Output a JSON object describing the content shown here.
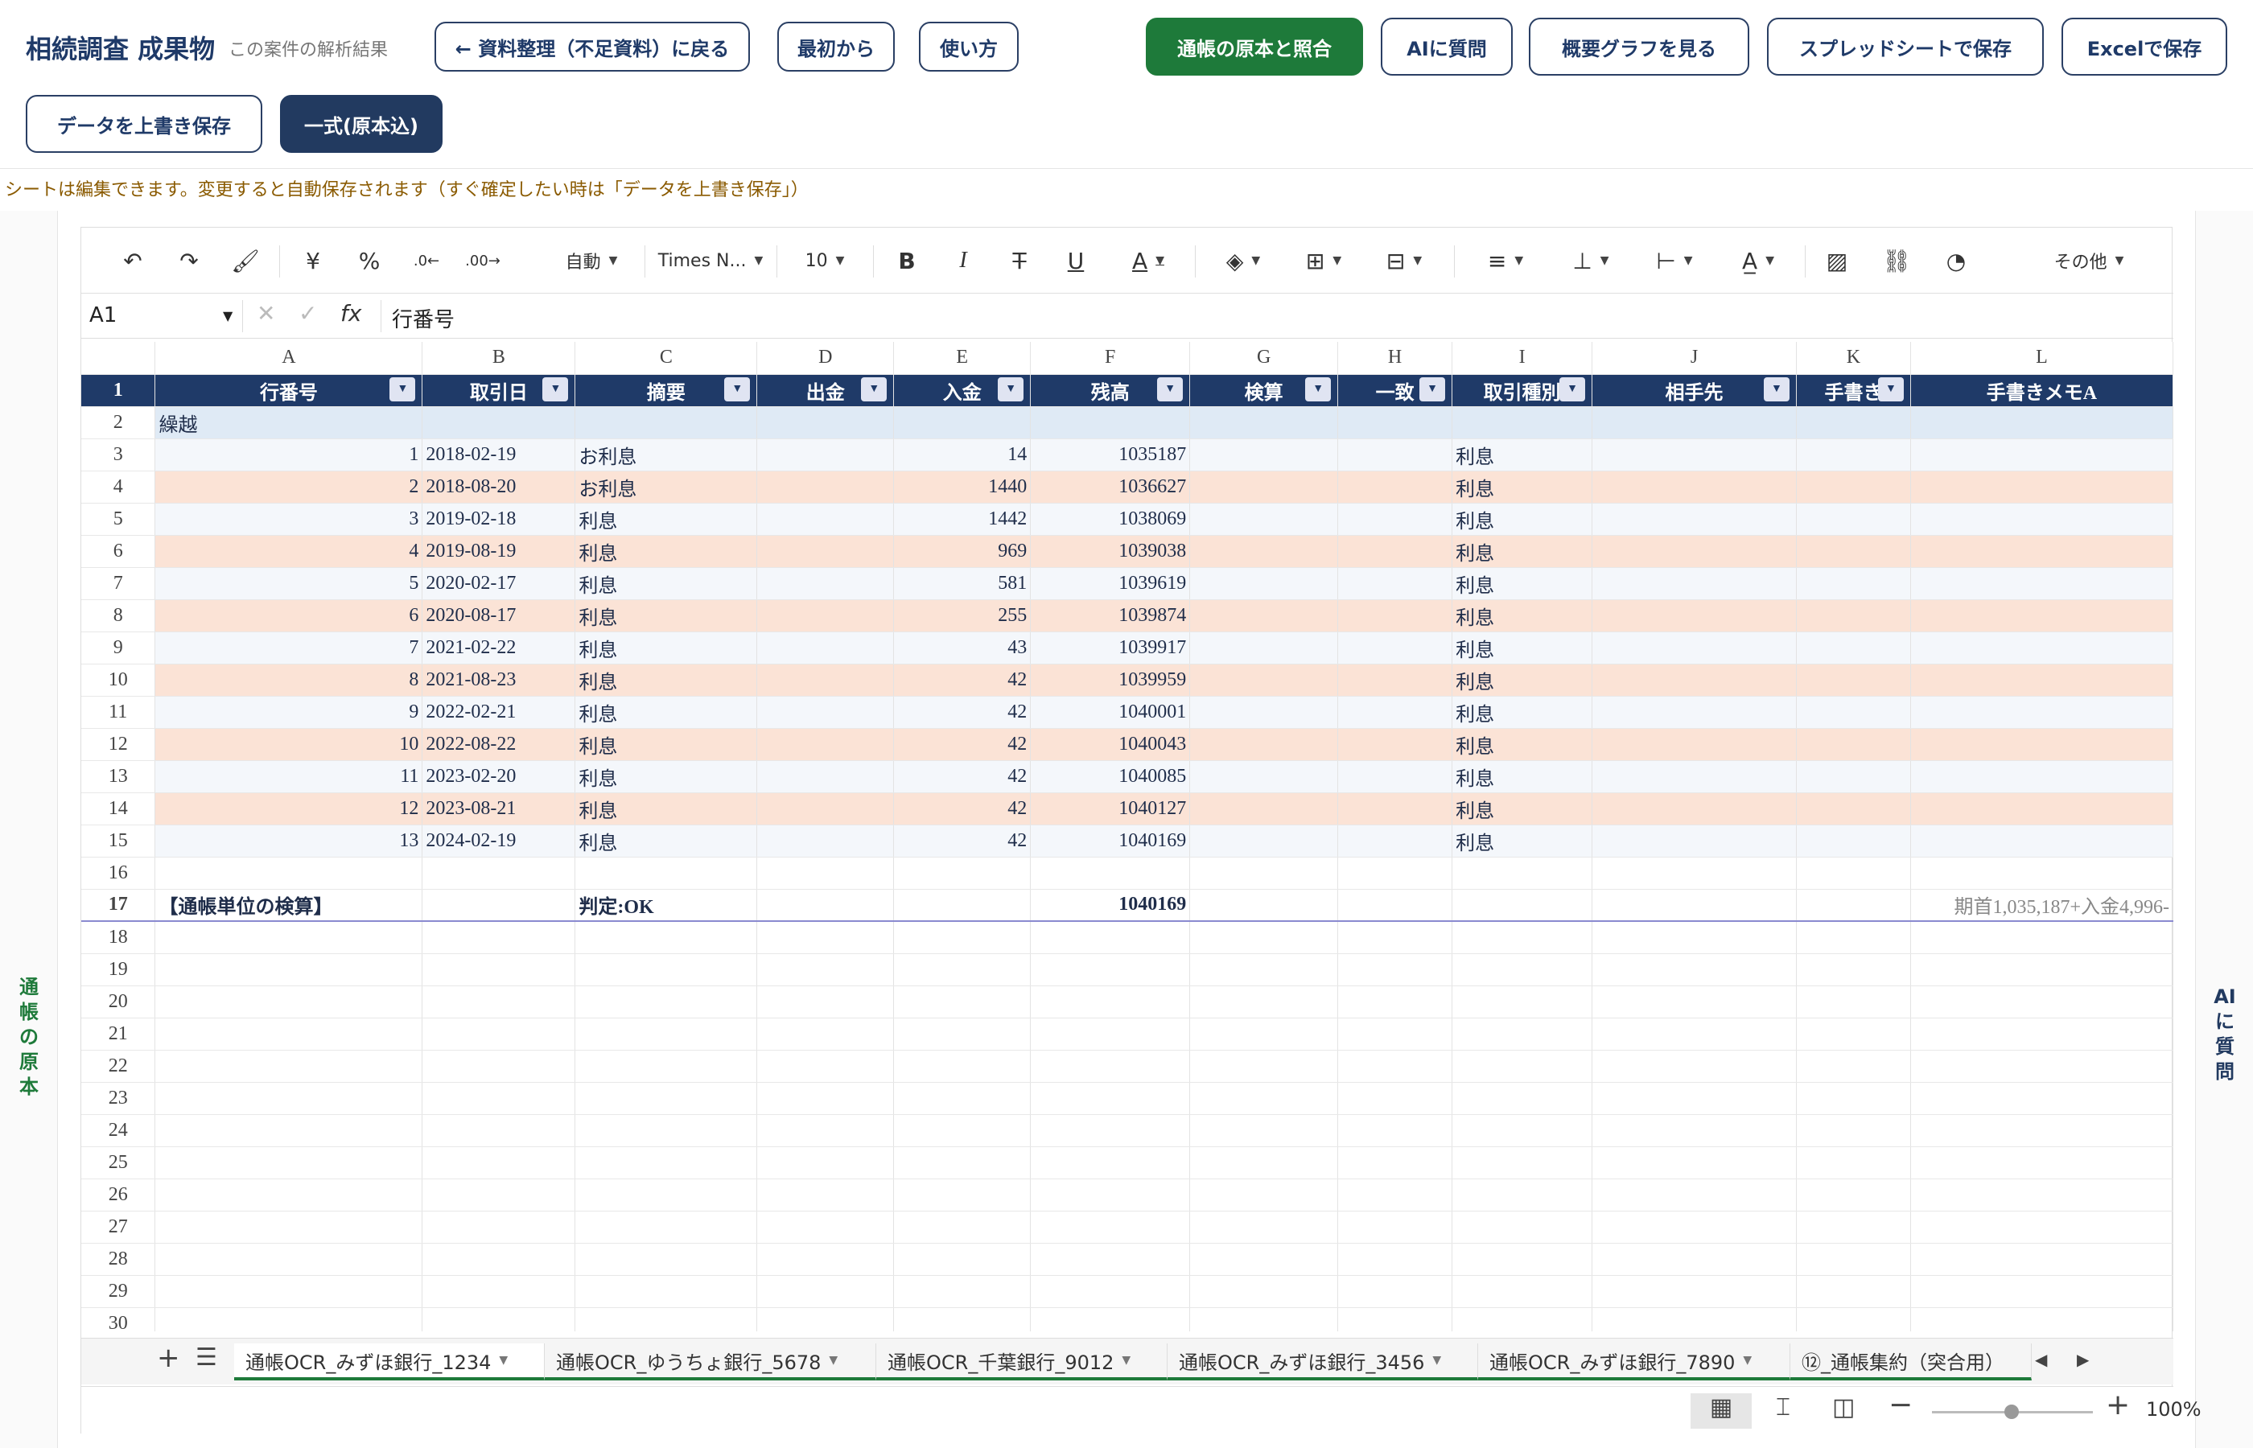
{
  "app": {
    "title": "相続調査 成果物",
    "subtitle": "この案件の解析結果"
  },
  "buttons": {
    "back": "← 資料整理（不足資料）に戻る",
    "restart": "最初から",
    "howto": "使い方",
    "compare": "通帳の原本と照合",
    "ask_ai": "AIに質問",
    "graph": "概要グラフを見る",
    "save_sheet": "スプレッドシートで保存",
    "save_excel": "Excelで保存",
    "overwrite": "データを上書き保存",
    "full_set": "一式(原本込)"
  },
  "notice": "シートは編集できます。変更すると自動保存されます（すぐ確定したい時は「データを上書き保存」）",
  "side": {
    "left": "通帳の原本",
    "right": "AIに質問"
  },
  "toolbar": {
    "format": "自動",
    "font": "Times N...",
    "size": "10",
    "more": "その他"
  },
  "formula": {
    "cell": "A1",
    "fx": "fx",
    "value": "行番号"
  },
  "columns": [
    "A",
    "B",
    "C",
    "D",
    "E",
    "F",
    "G",
    "H",
    "I",
    "J",
    "K",
    "L"
  ],
  "headers": [
    "行番号",
    "取引日",
    "摘要",
    "出金",
    "入金",
    "残高",
    "検算",
    "一致",
    "取引種別",
    "相手先",
    "手書き",
    "手書きメモA"
  ],
  "carry_label": "繰越",
  "rows": [
    {
      "no": "1",
      "date": "2018-02-19",
      "desc": "お利息",
      "out": "",
      "in": "14",
      "bal": "1035187",
      "type": "利息"
    },
    {
      "no": "2",
      "date": "2018-08-20",
      "desc": "お利息",
      "out": "",
      "in": "1440",
      "bal": "1036627",
      "type": "利息"
    },
    {
      "no": "3",
      "date": "2019-02-18",
      "desc": "利息",
      "out": "",
      "in": "1442",
      "bal": "1038069",
      "type": "利息"
    },
    {
      "no": "4",
      "date": "2019-08-19",
      "desc": "利息",
      "out": "",
      "in": "969",
      "bal": "1039038",
      "type": "利息"
    },
    {
      "no": "5",
      "date": "2020-02-17",
      "desc": "利息",
      "out": "",
      "in": "581",
      "bal": "1039619",
      "type": "利息"
    },
    {
      "no": "6",
      "date": "2020-08-17",
      "desc": "利息",
      "out": "",
      "in": "255",
      "bal": "1039874",
      "type": "利息"
    },
    {
      "no": "7",
      "date": "2021-02-22",
      "desc": "利息",
      "out": "",
      "in": "43",
      "bal": "1039917",
      "type": "利息"
    },
    {
      "no": "8",
      "date": "2021-08-23",
      "desc": "利息",
      "out": "",
      "in": "42",
      "bal": "1039959",
      "type": "利息"
    },
    {
      "no": "9",
      "date": "2022-02-21",
      "desc": "利息",
      "out": "",
      "in": "42",
      "bal": "1040001",
      "type": "利息"
    },
    {
      "no": "10",
      "date": "2022-08-22",
      "desc": "利息",
      "out": "",
      "in": "42",
      "bal": "1040043",
      "type": "利息"
    },
    {
      "no": "11",
      "date": "2023-02-20",
      "desc": "利息",
      "out": "",
      "in": "42",
      "bal": "1040085",
      "type": "利息"
    },
    {
      "no": "12",
      "date": "2023-08-21",
      "desc": "利息",
      "out": "",
      "in": "42",
      "bal": "1040127",
      "type": "利息"
    },
    {
      "no": "13",
      "date": "2024-02-19",
      "desc": "利息",
      "out": "",
      "in": "42",
      "bal": "1040169",
      "type": "利息"
    }
  ],
  "summary": {
    "label": "【通帳単位の検算】",
    "judge": "判定:OK",
    "balance": "1040169",
    "memo": "期首1,035,187+入金4,996-"
  },
  "tabs": [
    "通帳OCR_みずほ銀行_1234",
    "通帳OCR_ゆうちょ銀行_5678",
    "通帳OCR_千葉銀行_9012",
    "通帳OCR_みずほ銀行_3456",
    "通帳OCR_みずほ銀行_7890",
    "⑫_通帳集約（突合用）"
  ],
  "zoom": "100%",
  "colors": {
    "navy": "#1f3a68",
    "green": "#1e7a3a",
    "row_odd": "#f4f7fb",
    "row_even": "#fbe3d6",
    "carry": "#dfeaf5"
  }
}
